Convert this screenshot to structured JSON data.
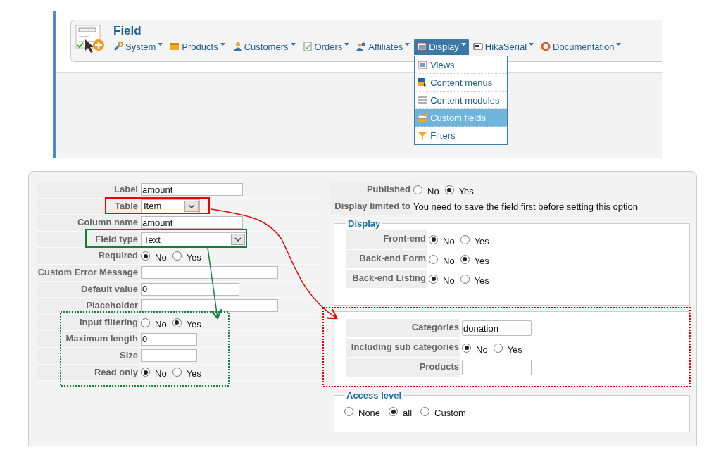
{
  "header": {
    "title": "Field",
    "menu": [
      {
        "label": "System",
        "selected": false
      },
      {
        "label": "Products",
        "selected": false
      },
      {
        "label": "Customers",
        "selected": false
      },
      {
        "label": "Orders",
        "selected": false
      },
      {
        "label": "Affiliates",
        "selected": false
      },
      {
        "label": "Display",
        "selected": true,
        "expanded": true,
        "dropdown": [
          {
            "label": "Views",
            "selected": false
          },
          {
            "label": "Content menus",
            "selected": false
          },
          {
            "label": "Content modules",
            "selected": false
          },
          {
            "label": "Custom fields",
            "selected": true
          },
          {
            "label": "Filters",
            "selected": false
          }
        ]
      },
      {
        "label": "HikaSerial",
        "selected": false
      },
      {
        "label": "Documentation",
        "selected": false
      }
    ]
  },
  "left_form": [
    {
      "kind": "text",
      "label": "Label",
      "value": "amount"
    },
    {
      "kind": "select",
      "label": "Table",
      "value": "Item"
    },
    {
      "kind": "text",
      "label": "Column name",
      "value": "amount"
    },
    {
      "kind": "select",
      "label": "Field type",
      "value": "Text"
    },
    {
      "kind": "radio",
      "label": "Required",
      "options": [
        {
          "label": "No",
          "selected": true
        },
        {
          "label": "Yes",
          "selected": false
        }
      ]
    },
    {
      "kind": "text",
      "label": "Custom Error Message"
    },
    {
      "kind": "text",
      "label": "Default value",
      "value": "0"
    },
    {
      "kind": "text",
      "label": "Placeholder"
    },
    {
      "kind": "radio",
      "label": "Input filtering",
      "options": [
        {
          "label": "No",
          "selected": false
        },
        {
          "label": "Yes",
          "selected": true
        }
      ]
    },
    {
      "kind": "text",
      "label": "Maximum length",
      "value": "0"
    },
    {
      "kind": "text",
      "label": "Size"
    },
    {
      "kind": "radio",
      "label": "Read only",
      "options": [
        {
          "label": "No",
          "selected": true
        },
        {
          "label": "Yes",
          "selected": false
        }
      ]
    }
  ],
  "right_form": {
    "rows": [
      {
        "kind": "radio",
        "label": "Published",
        "options": [
          {
            "label": "No",
            "selected": false
          },
          {
            "label": "Yes",
            "selected": true
          }
        ]
      },
      {
        "kind": "note",
        "label": "Display limited to",
        "value": "You need to save the field first before setting this option"
      }
    ],
    "display": {
      "legend": "Display",
      "rows": [
        {
          "kind": "radio",
          "label": "Front-end",
          "options": [
            {
              "label": "No",
              "selected": true
            },
            {
              "label": "Yes",
              "selected": false
            }
          ]
        },
        {
          "kind": "radio",
          "label": "Back-end Form",
          "options": [
            {
              "label": "No",
              "selected": false
            },
            {
              "label": "Yes",
              "selected": true
            }
          ]
        },
        {
          "kind": "radio",
          "label": "Back-end Listing",
          "options": [
            {
              "label": "No",
              "selected": true
            },
            {
              "label": "Yes",
              "selected": false
            }
          ]
        }
      ]
    },
    "restrictions": {
      "rows": [
        {
          "kind": "text",
          "label": "Categories",
          "value": "donation"
        },
        {
          "kind": "radio",
          "label": "Including sub categories",
          "options": [
            {
              "label": "No",
              "selected": true
            },
            {
              "label": "Yes",
              "selected": false
            }
          ]
        },
        {
          "kind": "text",
          "label": "Products"
        }
      ]
    },
    "access_level": {
      "legend": "Access level",
      "options": [
        {
          "label": "None",
          "selected": false
        },
        {
          "label": "all",
          "selected": true
        },
        {
          "label": "Custom",
          "selected": false
        }
      ]
    }
  }
}
